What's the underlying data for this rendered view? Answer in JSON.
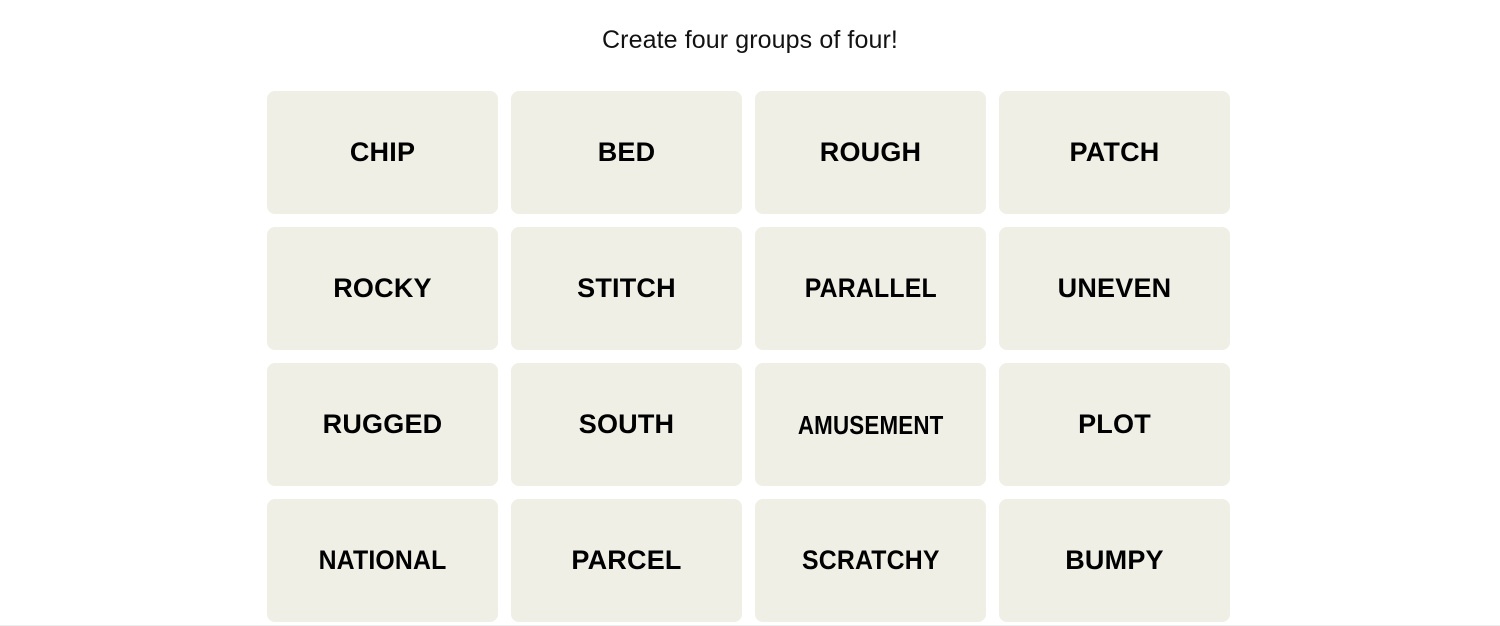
{
  "header": {
    "title": "Create four groups of four!"
  },
  "colors": {
    "page_background": "#ffffff",
    "tile_background": "#efefe6",
    "tile_text": "#000000",
    "title_text": "#121213",
    "divider": "#ededed"
  },
  "board": {
    "rows": 4,
    "columns": 4,
    "tiles": [
      {
        "label": "CHIP"
      },
      {
        "label": "BED"
      },
      {
        "label": "ROUGH"
      },
      {
        "label": "PATCH"
      },
      {
        "label": "ROCKY"
      },
      {
        "label": "STITCH"
      },
      {
        "label": "PARALLEL"
      },
      {
        "label": "UNEVEN"
      },
      {
        "label": "RUGGED"
      },
      {
        "label": "SOUTH"
      },
      {
        "label": "AMUSEMENT"
      },
      {
        "label": "PLOT"
      },
      {
        "label": "NATIONAL"
      },
      {
        "label": "PARCEL"
      },
      {
        "label": "SCRATCHY"
      },
      {
        "label": "BUMPY"
      }
    ]
  }
}
